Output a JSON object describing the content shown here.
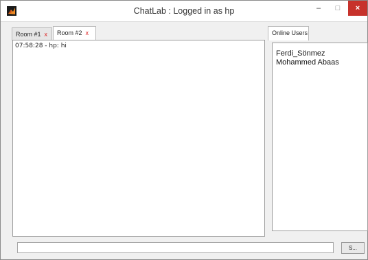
{
  "window": {
    "title": "ChatLab : Logged in as hp",
    "close_label": "×",
    "min_label": "–",
    "max_label": "□"
  },
  "tabs": [
    {
      "label": "Room #1",
      "close": "x"
    },
    {
      "label": "Room #2",
      "close": "x"
    }
  ],
  "chat": {
    "messages": [
      "07:58:28 - hp: hi"
    ]
  },
  "users_panel": {
    "tab_label": "Online Users",
    "users": [
      "Ferdi_Sönmez",
      "Mohammed Abaas"
    ]
  },
  "composer": {
    "input_value": "",
    "send_label": "S..."
  },
  "colors": {
    "close_button": "#c7322b",
    "tab_close": "#dd2222"
  },
  "icons": {
    "app": "matlab-icon"
  }
}
